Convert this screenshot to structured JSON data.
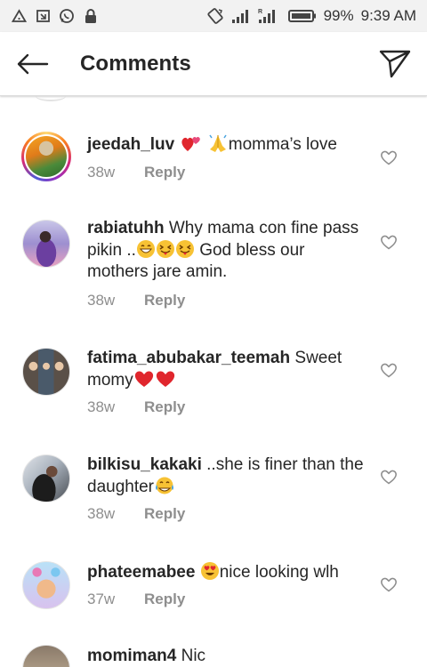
{
  "status_bar": {
    "battery": "99%",
    "time": "9:39 AM",
    "network_label": "R"
  },
  "header": {
    "title": "Comments"
  },
  "colors": {
    "text": "#262626",
    "secondary": "#8e8e8e",
    "heart_red": "#e0262d",
    "story_ring": "#d62976"
  },
  "comments": [
    {
      "username": "jeedah_luv",
      "pre_emoji": [
        "two-hearts-emoji",
        "praying-hands-emoji"
      ],
      "text": "momma’s love",
      "time": "38w",
      "reply": "Reply",
      "has_story_ring": true
    },
    {
      "username": "rabiatuhh",
      "text_1": "Why mama con fine pass pikin ..",
      "emojis_mid": [
        "grinning-emoji",
        "tongue-wink-emoji",
        "tongue-wink-emoji"
      ],
      "text_2": "God bless our mothers jare amin.",
      "time": "38w",
      "reply": "Reply"
    },
    {
      "username": "fatima_abubakar_teemah",
      "text": "Sweet momy",
      "post_emoji": [
        "red-heart-emoji",
        "red-heart-emoji"
      ],
      "time": "38w",
      "reply": "Reply"
    },
    {
      "username": "bilkisu_kakaki",
      "text": "..she is finer than the daughter",
      "post_emoji": [
        "tears-of-joy-emoji"
      ],
      "time": "38w",
      "reply": "Reply"
    },
    {
      "username": "phateemabee",
      "pre_emoji": [
        "heart-eyes-emoji"
      ],
      "text": "nice looking wlh",
      "time": "37w",
      "reply": "Reply"
    },
    {
      "username": "momiman4",
      "text": "Nic"
    }
  ]
}
